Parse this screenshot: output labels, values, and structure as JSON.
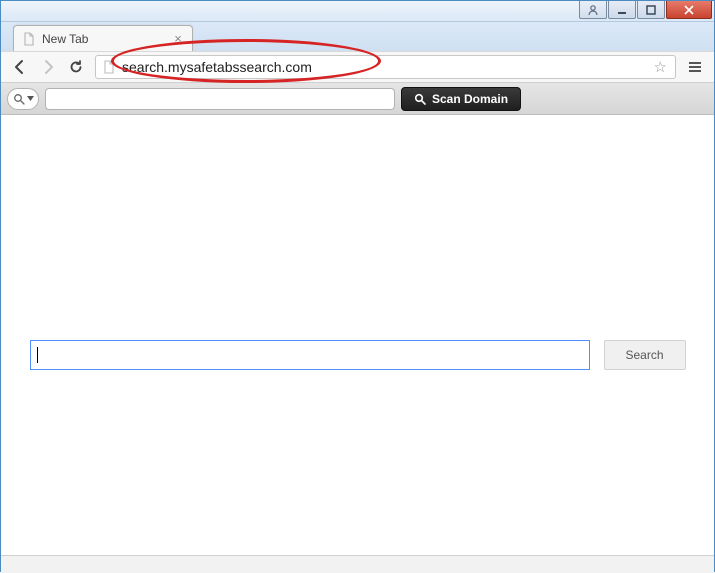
{
  "window": {
    "titlebar": {
      "user_btn": "user",
      "minimize_btn": "minimize",
      "maximize_btn": "maximize",
      "close_btn": "close"
    }
  },
  "tabs": [
    {
      "title": "New Tab"
    }
  ],
  "toolbar": {
    "url": "search.mysafetabssearch.com"
  },
  "ext_bar": {
    "scan_label": "Scan Domain",
    "input_value": ""
  },
  "page": {
    "search_value": "",
    "search_button_label": "Search"
  }
}
